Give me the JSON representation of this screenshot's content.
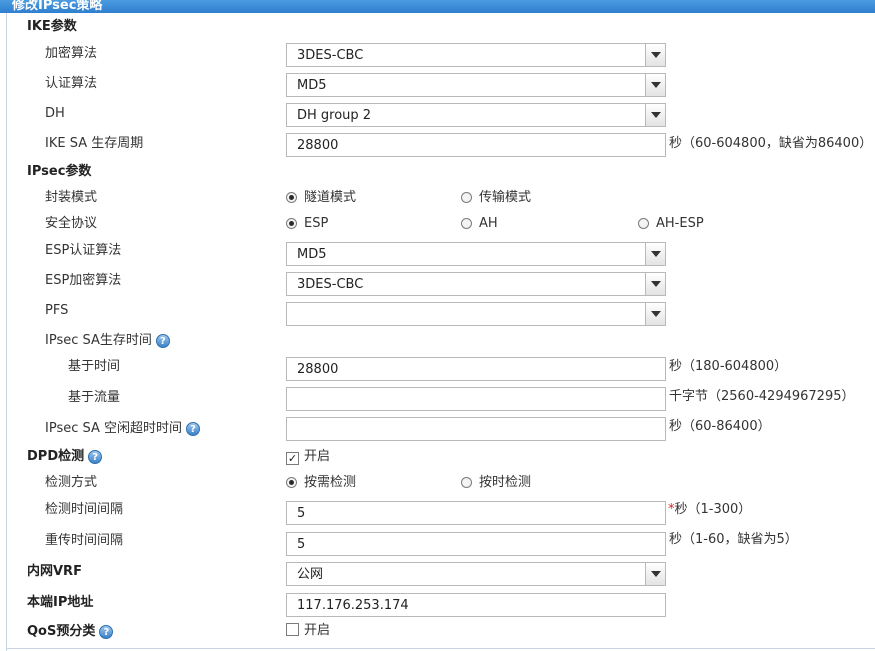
{
  "window": {
    "title": "修改IPsec策略"
  },
  "ike": {
    "section": "IKE参数",
    "encryption": {
      "label": "加密算法",
      "value": "3DES-CBC"
    },
    "auth": {
      "label": "认证算法",
      "value": "MD5"
    },
    "dh": {
      "label": "DH",
      "value": "DH group 2"
    },
    "lifetime": {
      "label": "IKE SA 生存周期",
      "value": "28800",
      "unit": "秒（60-604800，缺省为86400）"
    }
  },
  "ipsec": {
    "section": "IPsec参数",
    "encap": {
      "label": "封装模式",
      "options": [
        "隧道模式",
        "传输模式"
      ],
      "selected": "隧道模式"
    },
    "protocol": {
      "label": "安全协议",
      "options": [
        "ESP",
        "AH",
        "AH-ESP"
      ],
      "selected": "ESP"
    },
    "esp_auth": {
      "label": "ESP认证算法",
      "value": "MD5"
    },
    "esp_enc": {
      "label": "ESP加密算法",
      "value": "3DES-CBC"
    },
    "pfs": {
      "label": "PFS",
      "value": ""
    },
    "sa_lifetime": {
      "label": "IPsec SA生存时间",
      "time": {
        "label": "基于时间",
        "value": "28800",
        "unit": "秒（180-604800）"
      },
      "traffic": {
        "label": "基于流量",
        "value": "",
        "unit": "千字节（2560-4294967295）"
      }
    },
    "idle_timeout": {
      "label": "IPsec SA 空闲超时时间",
      "value": "",
      "unit": "秒（60-86400）"
    }
  },
  "dpd": {
    "label": "DPD检测",
    "enable_label": "开启",
    "enabled": true,
    "mode": {
      "label": "检测方式",
      "options": [
        "按需检测",
        "按时检测"
      ],
      "selected": "按需检测"
    },
    "interval": {
      "label": "检测时间间隔",
      "value": "5",
      "required_mark": "*",
      "unit": "秒（1-300）"
    },
    "retry": {
      "label": "重传时间间隔",
      "value": "5",
      "unit": "秒（1-60，缺省为5）"
    }
  },
  "vrf": {
    "label": "内网VRF",
    "value": "公网"
  },
  "local_ip": {
    "label": "本端IP地址",
    "value": "117.176.253.174"
  },
  "qos": {
    "label": "QoS预分类",
    "enable_label": "开启",
    "enabled": false
  },
  "icons": {
    "help": "question-mark-help-icon",
    "dropdown": "chevron-down-icon"
  },
  "colors": {
    "title_bar": "#2f7fcf",
    "help_icon": "#3d82c8",
    "required": "#e02020"
  }
}
